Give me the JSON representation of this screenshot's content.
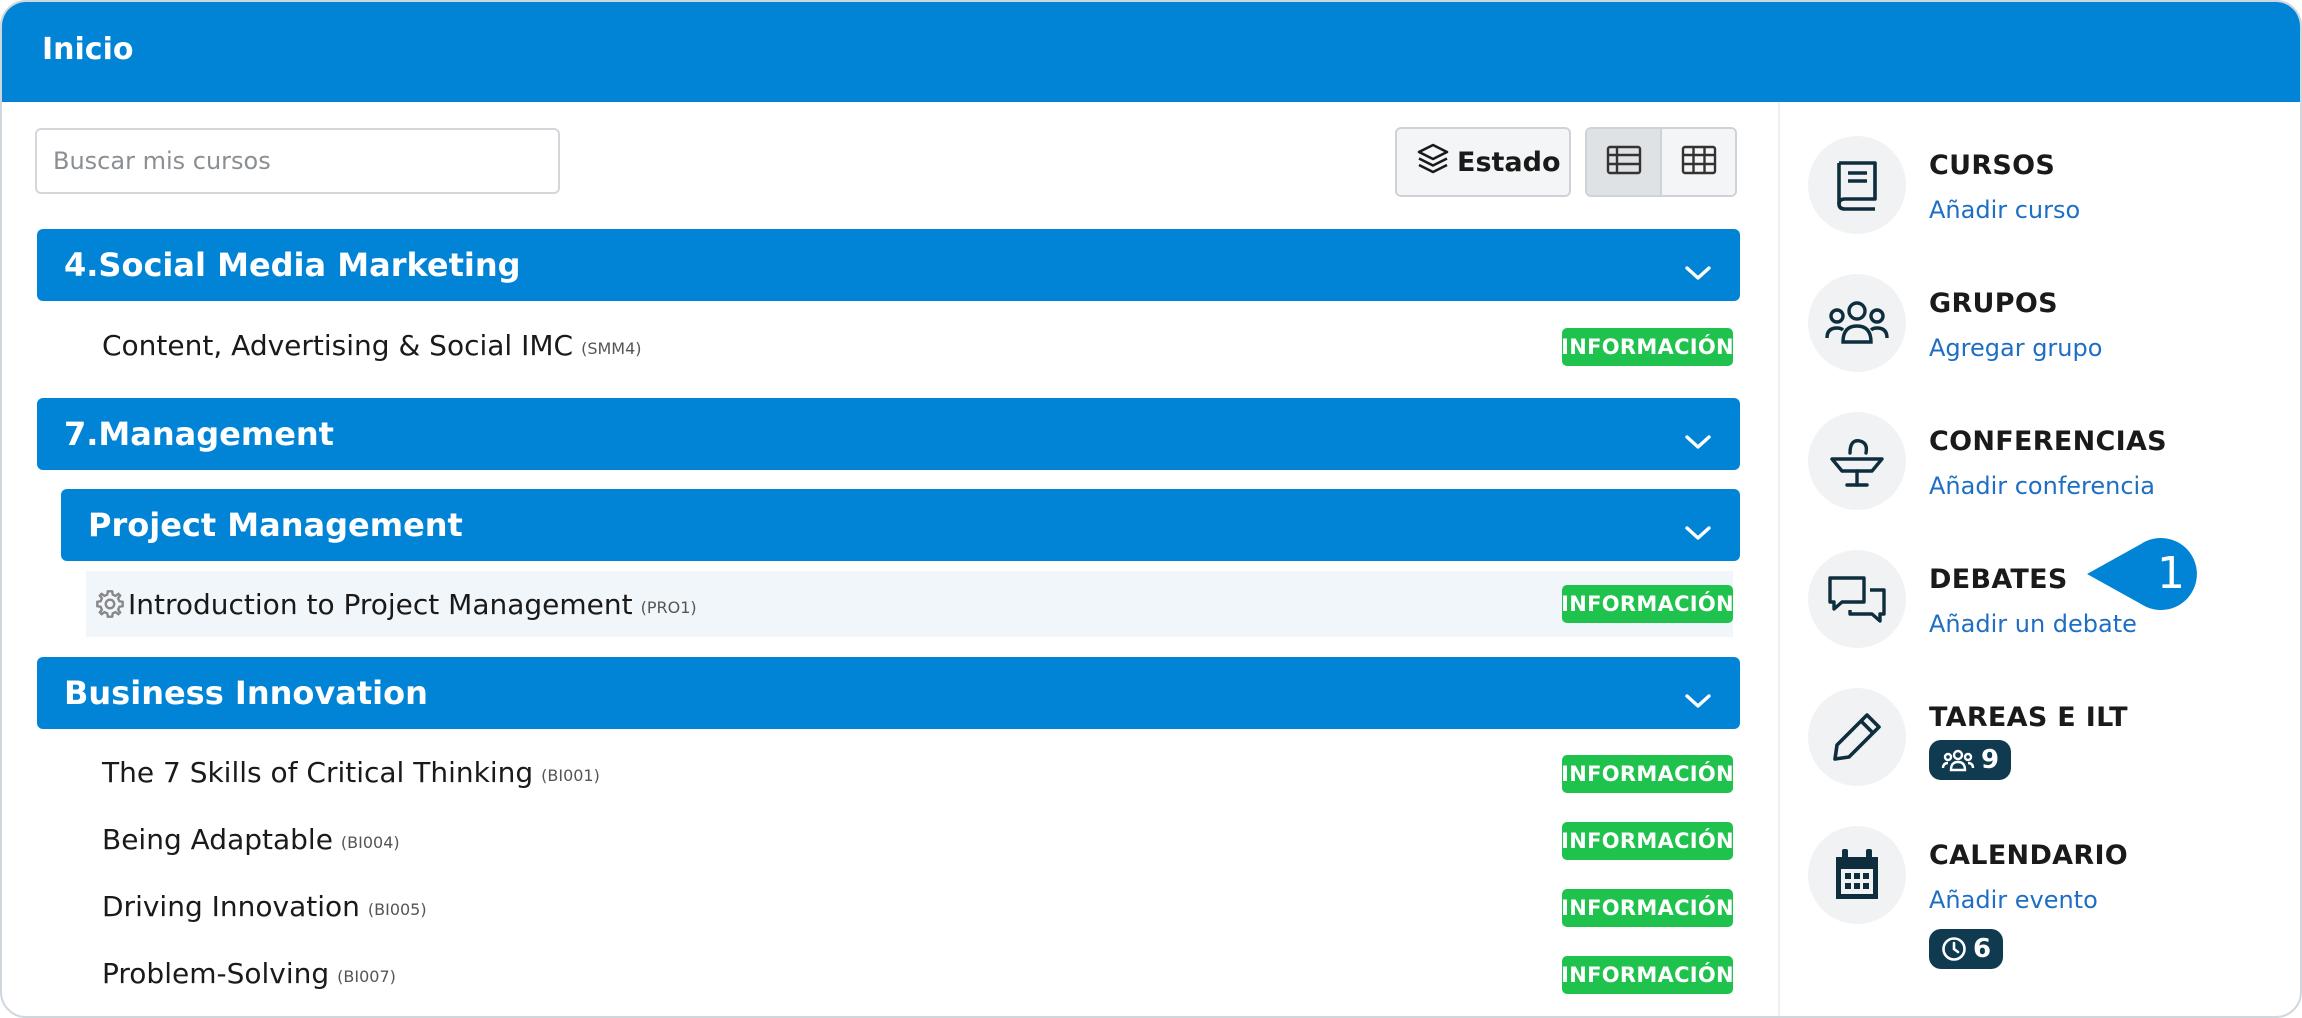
{
  "header": {
    "title": "Inicio"
  },
  "search": {
    "placeholder": "Buscar mis cursos"
  },
  "toolbar": {
    "estado_label": "Estado"
  },
  "categories": [
    {
      "title": "4.Social Media Marketing",
      "courses": [
        {
          "name": "Content, Advertising & Social IMC",
          "code": "(SMM4)",
          "badge": "INFORMACIÓN"
        }
      ]
    },
    {
      "title": "7.Management",
      "subcategory": {
        "title": "Project Management",
        "courses": [
          {
            "name": "Introduction to Project Management",
            "code": "(PRO1)",
            "badge": "INFORMACIÓN"
          }
        ]
      }
    },
    {
      "title": "Business Innovation",
      "courses": [
        {
          "name": "The 7 Skills of Critical Thinking",
          "code": "(BI001)",
          "badge": "INFORMACIÓN"
        },
        {
          "name": "Being Adaptable",
          "code": "(BI004)",
          "badge": "INFORMACIÓN"
        },
        {
          "name": "Driving Innovation",
          "code": "(BI005)",
          "badge": "INFORMACIÓN"
        },
        {
          "name": "Problem-Solving",
          "code": "(BI007)",
          "badge": "INFORMACIÓN"
        }
      ]
    }
  ],
  "sidebar": {
    "cursos": {
      "label": "CURSOS",
      "link": "Añadir curso"
    },
    "grupos": {
      "label": "GRUPOS",
      "link": "Agregar grupo"
    },
    "conferencias": {
      "label": "CONFERENCIAS",
      "link": "Añadir conferencia"
    },
    "debates": {
      "label": "DEBATES",
      "link": "Añadir un debate"
    },
    "tareas": {
      "label": "TAREAS E ILT",
      "count": "9"
    },
    "calendario": {
      "label": "CALENDARIO",
      "link": "Añadir evento",
      "count": "6"
    }
  },
  "callout": {
    "number": "1"
  },
  "colors": {
    "primary": "#0284d6",
    "badge_green": "#1ec24c",
    "link": "#1e6fc4",
    "dark_badge": "#0f3a4f"
  }
}
